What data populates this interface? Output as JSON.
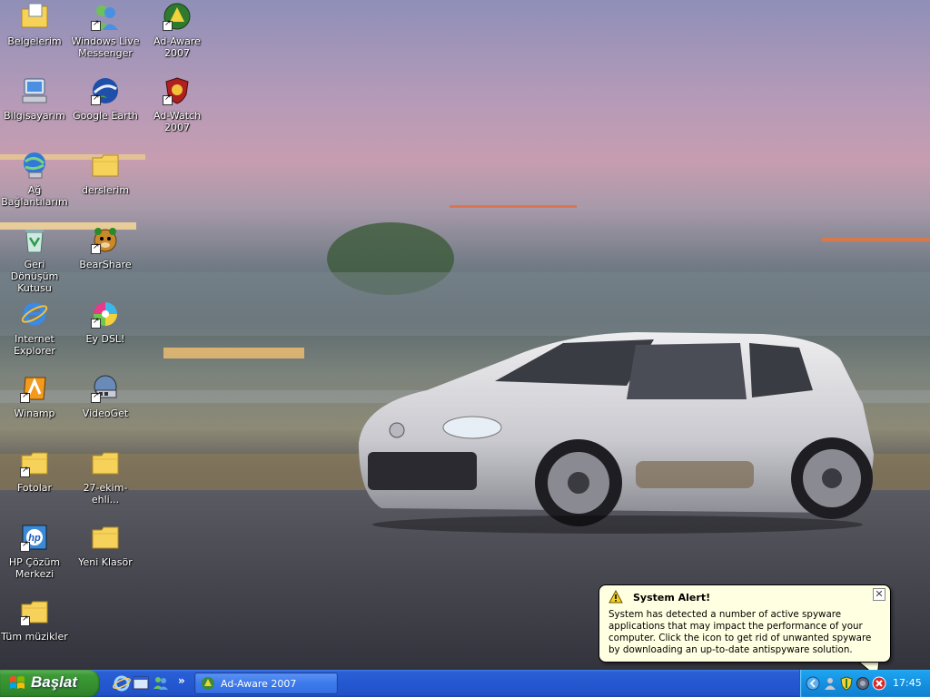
{
  "desktop": {
    "icons": [
      {
        "label": "Belgelerim",
        "icon": "my-documents-folder-icon"
      },
      {
        "label": "Windows Live\nMessenger",
        "icon": "messenger-icon"
      },
      {
        "label": "Ad-Aware\n2007",
        "icon": "ad-aware-icon"
      },
      {
        "label": "Bilgisayarım",
        "icon": "my-computer-icon"
      },
      {
        "label": "Google Earth",
        "icon": "google-earth-icon"
      },
      {
        "label": "Ad-Watch\n2007",
        "icon": "ad-watch-icon"
      },
      {
        "label": "Ağ\nBağlantılarım",
        "icon": "network-connections-icon"
      },
      {
        "label": "derslerim",
        "icon": "folder-icon"
      },
      {
        "label": "Geri Dönüşüm\nKutusu",
        "icon": "recycle-bin-icon"
      },
      {
        "label": "BearShare",
        "icon": "bearshare-icon"
      },
      {
        "label": "Internet\nExplorer",
        "icon": "internet-explorer-icon"
      },
      {
        "label": "Ey DSL!",
        "icon": "ey-dsl-icon"
      },
      {
        "label": "Winamp",
        "icon": "winamp-icon"
      },
      {
        "label": "VideoGet",
        "icon": "videoget-icon"
      },
      {
        "label": "Fotolar",
        "icon": "folder-shortcut-icon"
      },
      {
        "label": "27-ekim-ehli...",
        "icon": "folder-icon"
      },
      {
        "label": "HP Çözüm\nMerkezi",
        "icon": "hp-solution-center-icon"
      },
      {
        "label": "Yeni Klasör",
        "icon": "folder-icon"
      },
      {
        "label": "Tüm müzikler",
        "icon": "folder-shortcut-icon"
      }
    ]
  },
  "balloon": {
    "title": "System Alert!",
    "message": "System has detected a number of active spyware applications that may impact the performance of your computer. Click the icon to get rid of unwanted spyware by downloading an up-to-date antispyware solution.",
    "close_glyph": "✕"
  },
  "taskbar": {
    "start_label": "Başlat",
    "quicklaunch_more": "»",
    "task_button_label": "Ad-Aware 2007",
    "clock": "17:45"
  },
  "colors": {
    "taskbar_blue": "#2458d0",
    "start_green": "#3c9a36",
    "tray_blue": "#1591e0",
    "balloon_bg": "#ffffe1"
  }
}
